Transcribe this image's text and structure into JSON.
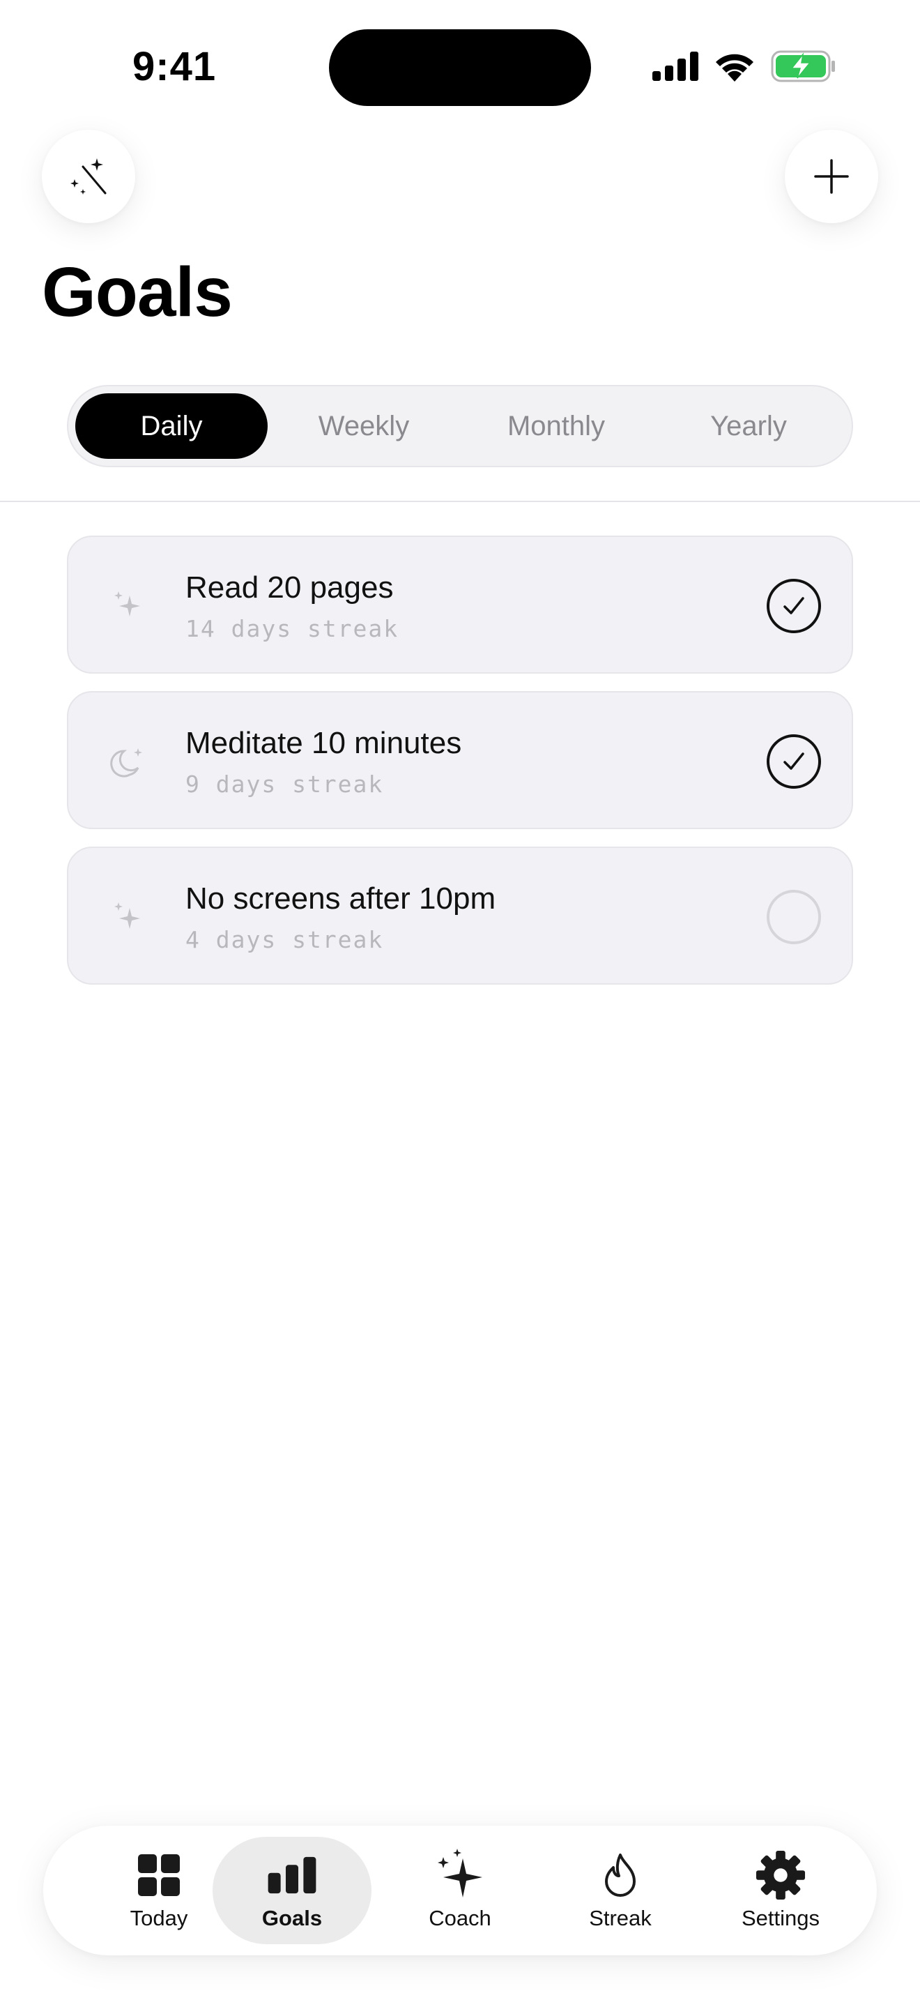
{
  "status_bar": {
    "time": "9:41"
  },
  "header": {
    "title": "Goals"
  },
  "segments": [
    {
      "label": "Daily",
      "active": true
    },
    {
      "label": "Weekly",
      "active": false
    },
    {
      "label": "Monthly",
      "active": false
    },
    {
      "label": "Yearly",
      "active": false
    }
  ],
  "goals": [
    {
      "icon": "sparkles-icon",
      "title": "Read 20 pages",
      "streak": "14 days streak",
      "done": true
    },
    {
      "icon": "moon-stars-icon",
      "title": "Meditate 10 minutes",
      "streak": "9 days streak",
      "done": true
    },
    {
      "icon": "sparkles-icon",
      "title": "No screens after 10pm",
      "streak": "4 days streak",
      "done": false
    }
  ],
  "tabs": [
    {
      "icon": "grid-icon",
      "label": "Today",
      "active": false
    },
    {
      "icon": "bar-chart-icon",
      "label": "Goals",
      "active": true
    },
    {
      "icon": "sparkle-icon",
      "label": "Coach",
      "active": false
    },
    {
      "icon": "flame-icon",
      "label": "Streak",
      "active": false
    },
    {
      "icon": "gear-icon",
      "label": "Settings",
      "active": false
    }
  ],
  "colors": {
    "battery": "#34c759",
    "active_segment": "#000000",
    "card_bg": "#f2f2f6"
  }
}
